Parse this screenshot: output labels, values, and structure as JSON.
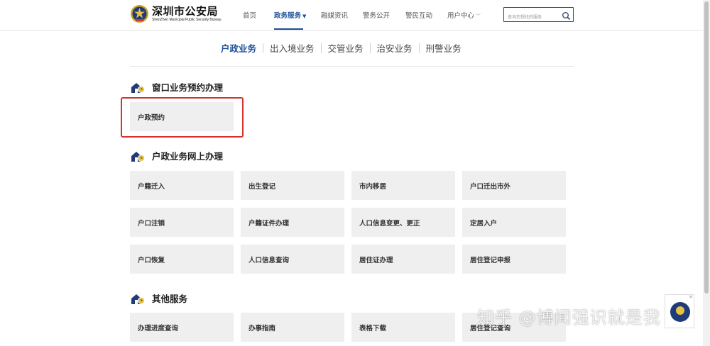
{
  "header": {
    "logo_title": "深圳市公安局",
    "logo_subtitle": "ShenZhen Municipal Public Security Bureau",
    "nav": [
      {
        "label": "首页"
      },
      {
        "label": "政务服务"
      },
      {
        "label": "融媒资讯"
      },
      {
        "label": "警务公开"
      },
      {
        "label": "警民互动"
      },
      {
        "label": "用户中心"
      }
    ],
    "search_placeholder": "查询您想找的服务"
  },
  "subtabs": [
    "户政业务",
    "出入境业务",
    "交管业务",
    "治安业务",
    "刑警业务"
  ],
  "sections": [
    {
      "title": "窗口业务预约办理",
      "items": [
        "户政预约"
      ]
    },
    {
      "title": "户政业务网上办理",
      "items": [
        "户籍迁入",
        "出生登记",
        "市内移居",
        "户口迁出市外",
        "户口注销",
        "户籍证件办理",
        "人口信息变更、更正",
        "定居入户",
        "户口恢复",
        "人口信息查询",
        "居住证办理",
        "居住登记申报"
      ]
    },
    {
      "title": "其他服务",
      "items": [
        "办理进度查询",
        "办事指南",
        "表格下载",
        "居住登记查询"
      ]
    }
  ],
  "watermark": "知乎 @博闻强识就是我",
  "colors": {
    "accent": "#1d4f9a",
    "highlight": "#d6322c",
    "card": "#efefef"
  }
}
